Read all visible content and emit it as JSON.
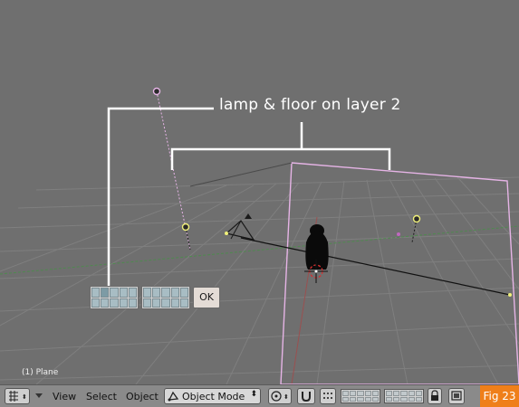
{
  "viewport": {
    "annotation": "lamp & floor on layer 2",
    "object_label": "(1) Plane"
  },
  "layer_popup": {
    "ok_label": "OK",
    "active_layer": 2
  },
  "header": {
    "menus": [
      "View",
      "Select",
      "Object"
    ],
    "mode_label": "Object Mode",
    "icons": [
      "grid-icon",
      "view-menu-arrow-icon",
      "object-mode-icon",
      "pivot-icon",
      "snap-magnet-icon",
      "layers-grid-icon",
      "lock-icon",
      "render-icon"
    ]
  },
  "badge": {
    "label": "Fig 23",
    "color": "#ef7f1a"
  },
  "colors": {
    "background": "#6f6f6f",
    "grid": "#7c7c7c",
    "selection_outline": "#e6b4e6",
    "header": "#8a8a8a"
  }
}
